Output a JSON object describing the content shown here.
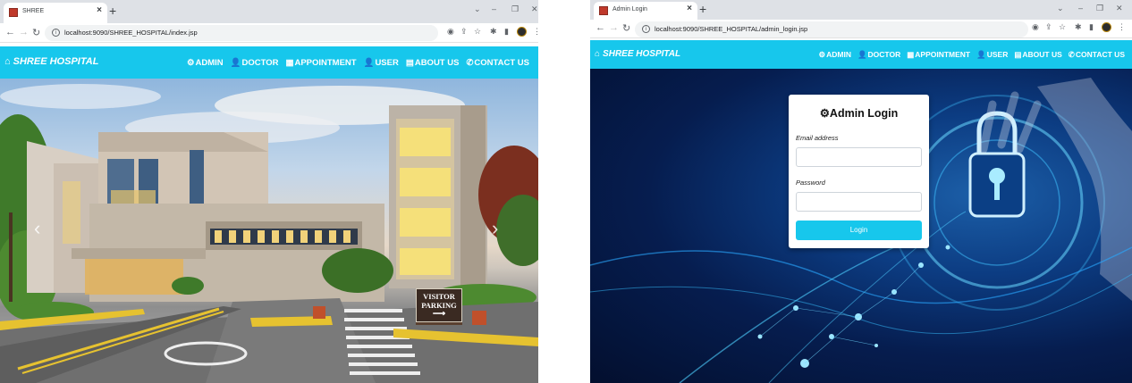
{
  "left_window": {
    "tab_title": "SHREE",
    "url": "localhost:9090/SHREE_HOSPITAL/index.jsp",
    "brand": "SHREE HOSPITAL",
    "menu": [
      {
        "icon": "gears-icon",
        "label": "ADMIN"
      },
      {
        "icon": "user-icon",
        "label": "DOCTOR"
      },
      {
        "icon": "calendar-icon",
        "label": "APPOINTMENT"
      },
      {
        "icon": "user-icon",
        "label": "USER"
      },
      {
        "icon": "id-card-icon",
        "label": "ABOUT US"
      },
      {
        "icon": "phone-icon",
        "label": "CONTACT US"
      }
    ],
    "hero": {
      "sign_line1": "VISITOR",
      "sign_line2": "PARKING",
      "prev_glyph": "‹",
      "next_glyph": "›"
    }
  },
  "right_window": {
    "tab_title": "Admin Login",
    "url": "localhost:9090/SHREE_HOSPITAL/admin_login.jsp",
    "brand": "SHREE HOSPITAL",
    "menu": [
      {
        "icon": "gears-icon",
        "label": "ADMIN"
      },
      {
        "icon": "user-icon",
        "label": "DOCTOR"
      },
      {
        "icon": "calendar-icon",
        "label": "APPOINTMENT"
      },
      {
        "icon": "user-icon",
        "label": "USER"
      },
      {
        "icon": "id-card-icon",
        "label": "ABOUT US"
      },
      {
        "icon": "phone-icon",
        "label": "CONTACT US"
      }
    ],
    "login_card": {
      "title": "Admin Login",
      "email_label": "Email address",
      "email_value": "",
      "password_label": "Password",
      "password_value": "",
      "button_label": "Login"
    }
  },
  "colors": {
    "navbar": "#17c7ec",
    "tabstrip": "#dee1e6",
    "login_button": "#17c7ec"
  }
}
